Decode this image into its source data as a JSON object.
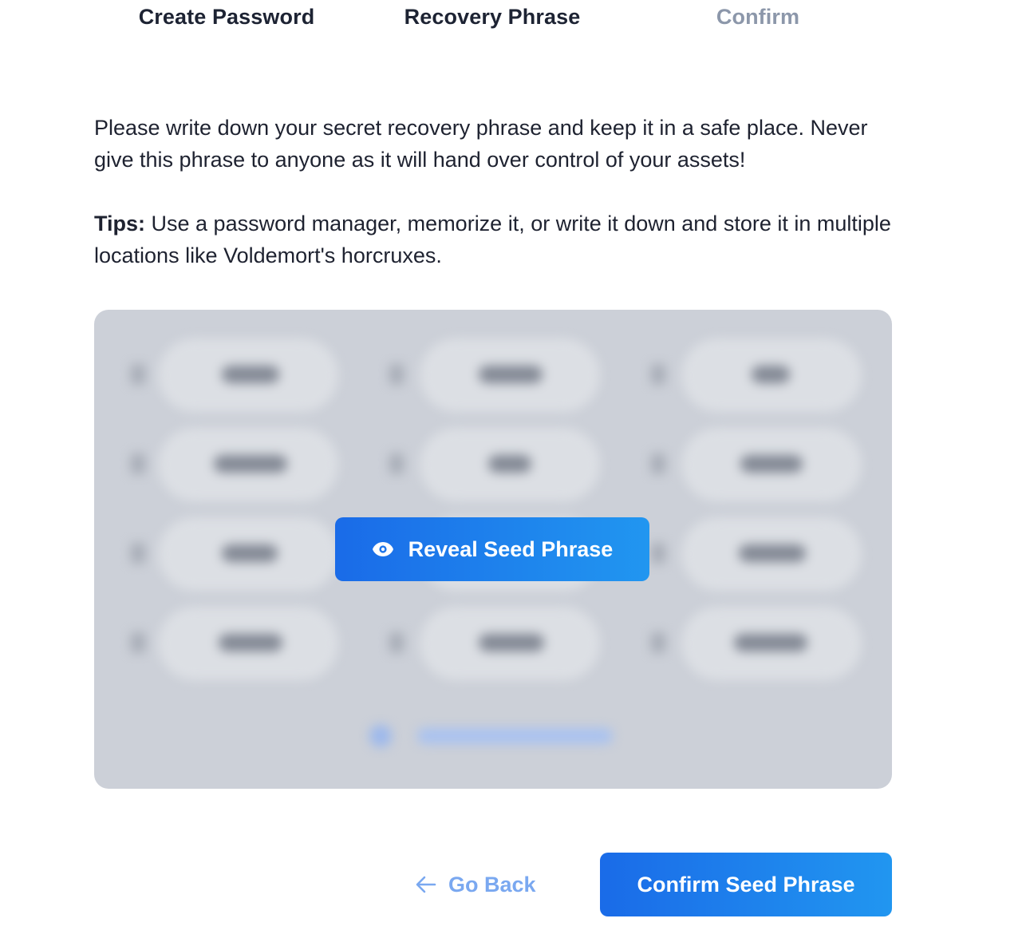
{
  "stepper": {
    "steps": [
      {
        "label": "Create Password",
        "state": "complete"
      },
      {
        "label": "Recovery Phrase",
        "state": "active"
      },
      {
        "label": "Confirm",
        "state": "upcoming"
      }
    ]
  },
  "instructions": {
    "warning": "Please write down your secret recovery phrase and keep it in a safe place. Never give this phrase to anyone as it will hand over control of your assets!",
    "tips_label": "Tips:",
    "tips_text": " Use a password manager, memorize it, or write it down and store it in multiple locations like Voldemort's horcruxes."
  },
  "seed_box": {
    "reveal_label": "Reveal Seed Phrase",
    "reveal_icon": "eye-icon",
    "state": "hidden-blurred"
  },
  "footer": {
    "back_label": "Go Back",
    "back_icon": "arrow-left-icon",
    "confirm_label": "Confirm Seed Phrase"
  },
  "colors": {
    "primary_start": "#1a6be8",
    "primary_end": "#2196f0",
    "muted_step": "#8c97aa",
    "back_link": "#7aa8f0",
    "seed_box_bg": "#ccd0d8"
  }
}
